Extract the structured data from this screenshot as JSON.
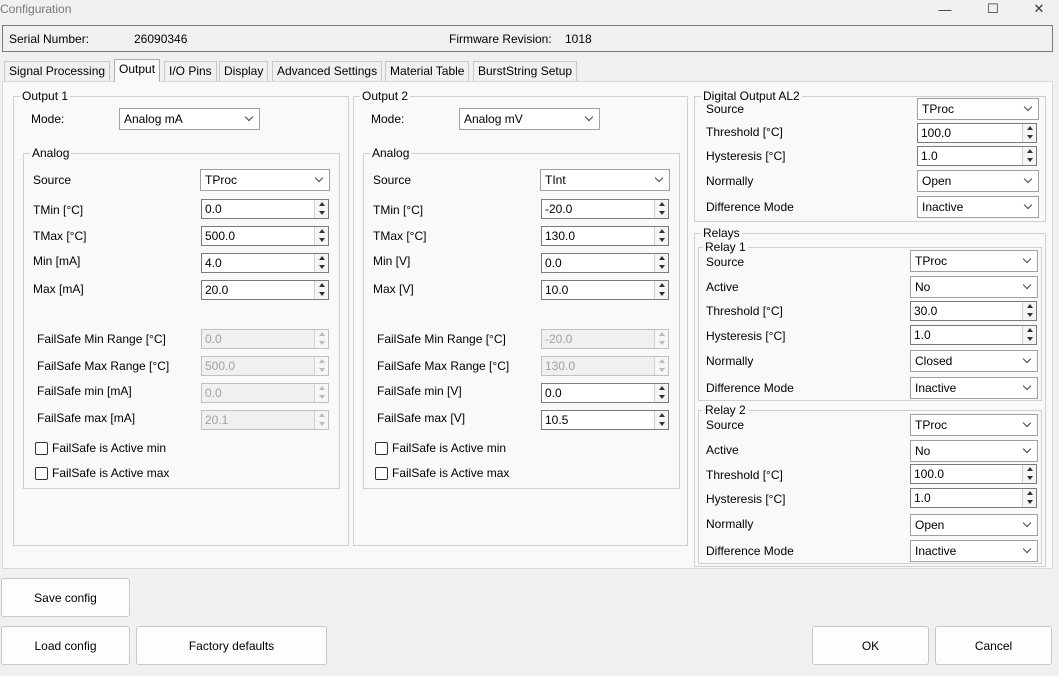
{
  "window": {
    "title": "Configuration",
    "min_glyph": "—",
    "max_glyph": "☐",
    "close_glyph": "✕"
  },
  "info": {
    "serial_label": "Serial Number:",
    "serial_value": "26090346",
    "fw_label": "Firmware Revision:",
    "fw_value": "1018"
  },
  "tabs": [
    "Signal Processing",
    "Output",
    "I/O Pins",
    "Display",
    "Advanced Settings",
    "Material Table",
    "BurstString Setup"
  ],
  "output1": {
    "title": "Output 1",
    "mode_label": "Mode:",
    "mode_value": "Analog mA",
    "analog_title": "Analog",
    "source_label": "Source",
    "source_value": "TProc",
    "tmin_label": "TMin [°C]",
    "tmin_value": "0.0",
    "tmax_label": "TMax [°C]",
    "tmax_value": "500.0",
    "min_label": "Min [mA]",
    "min_value": "4.0",
    "max_label": "Max [mA]",
    "max_value": "20.0",
    "fs_min_range_label": "FailSafe Min Range [°C]",
    "fs_min_range_value": "0.0",
    "fs_max_range_label": "FailSafe Max Range [°C]",
    "fs_max_range_value": "500.0",
    "fs_min_label": "FailSafe min [mA]",
    "fs_min_value": "0.0",
    "fs_max_label": "FailSafe max [mA]",
    "fs_max_value": "20.1",
    "fs_active_min": "FailSafe is Active min",
    "fs_active_max": "FailSafe is Active max"
  },
  "output2": {
    "title": "Output 2",
    "mode_label": "Mode:",
    "mode_value": "Analog mV",
    "analog_title": "Analog",
    "source_label": "Source",
    "source_value": "TInt",
    "tmin_label": "TMin [°C]",
    "tmin_value": "-20.0",
    "tmax_label": "TMax [°C]",
    "tmax_value": "130.0",
    "min_label": "Min [V]",
    "min_value": "0.0",
    "max_label": "Max [V]",
    "max_value": "10.0",
    "fs_min_range_label": "FailSafe Min Range [°C]",
    "fs_min_range_value": "-20.0",
    "fs_max_range_label": "FailSafe Max Range [°C]",
    "fs_max_range_value": "130.0",
    "fs_min_label": "FailSafe min [V]",
    "fs_min_value": "0.0",
    "fs_max_label": "FailSafe max [V]",
    "fs_max_value": "10.5",
    "fs_active_min": "FailSafe is Active min",
    "fs_active_max": "FailSafe is Active max"
  },
  "digital": {
    "title": "Digital Output AL2",
    "source_label": "Source",
    "source_value": "TProc",
    "threshold_label": "Threshold [°C]",
    "threshold_value": "100.0",
    "hyst_label": "Hysteresis [°C]",
    "hyst_value": "1.0",
    "normally_label": "Normally",
    "normally_value": "Open",
    "diff_label": "Difference Mode",
    "diff_value": "Inactive"
  },
  "relays": {
    "title": "Relays",
    "relay1": {
      "title": "Relay 1",
      "source_label": "Source",
      "source_value": "TProc",
      "active_label": "Active",
      "active_value": "No",
      "threshold_label": "Threshold [°C]",
      "threshold_value": "30.0",
      "hyst_label": "Hysteresis [°C]",
      "hyst_value": "1.0",
      "normally_label": "Normally",
      "normally_value": "Closed",
      "diff_label": "Difference Mode",
      "diff_value": "Inactive"
    },
    "relay2": {
      "title": "Relay 2",
      "source_label": "Source",
      "source_value": "TProc",
      "active_label": "Active",
      "active_value": "No",
      "threshold_label": "Threshold [°C]",
      "threshold_value": "100.0",
      "hyst_label": "Hysteresis [°C]",
      "hyst_value": "1.0",
      "normally_label": "Normally",
      "normally_value": "Open",
      "diff_label": "Difference Mode",
      "diff_value": "Inactive"
    }
  },
  "buttons": {
    "save": "Save config",
    "load": "Load config",
    "factory": "Factory defaults",
    "ok": "OK",
    "cancel": "Cancel"
  }
}
